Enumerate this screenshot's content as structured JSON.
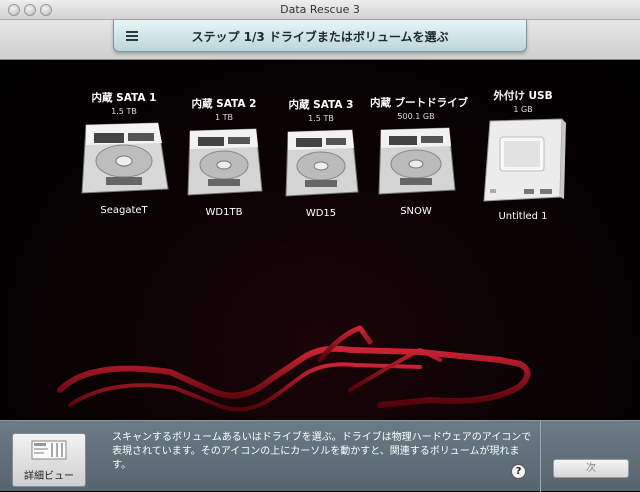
{
  "window": {
    "title": "Data Rescue 3"
  },
  "step": {
    "title": "ステップ 1/3 ドライブまたはボリュームを選ぶ"
  },
  "drives": [
    {
      "name": "内蔵 SATA 1",
      "size": "1.5 TB",
      "label": "SeagateT",
      "kind": "internal"
    },
    {
      "name": "内蔵 SATA 2",
      "size": "1 TB",
      "label": "WD1TB",
      "kind": "internal"
    },
    {
      "name": "内蔵 SATA 3",
      "size": "1.5 TB",
      "label": "WD15",
      "kind": "internal"
    },
    {
      "name": "内蔵 ブートドライブ",
      "size": "500.1 GB",
      "label": "SNOW",
      "kind": "internal"
    },
    {
      "name": "外付け USB",
      "size": "1 GB",
      "label": "Untitled 1",
      "kind": "external"
    }
  ],
  "footer": {
    "detail_button": "詳細ビュー",
    "help_text": "スキャンするボリュームあるいはドライブを選ぶ。ドライブは物理ハードウェアのアイコンで表現されています。そのアイコンの上にカーソルを動かすと、関連するボリュームが現れます。",
    "help_icon": "?",
    "next_button": "次"
  },
  "colors": {
    "accent_red": "#b0101c",
    "toolbar_step": "#cfe3e8"
  }
}
